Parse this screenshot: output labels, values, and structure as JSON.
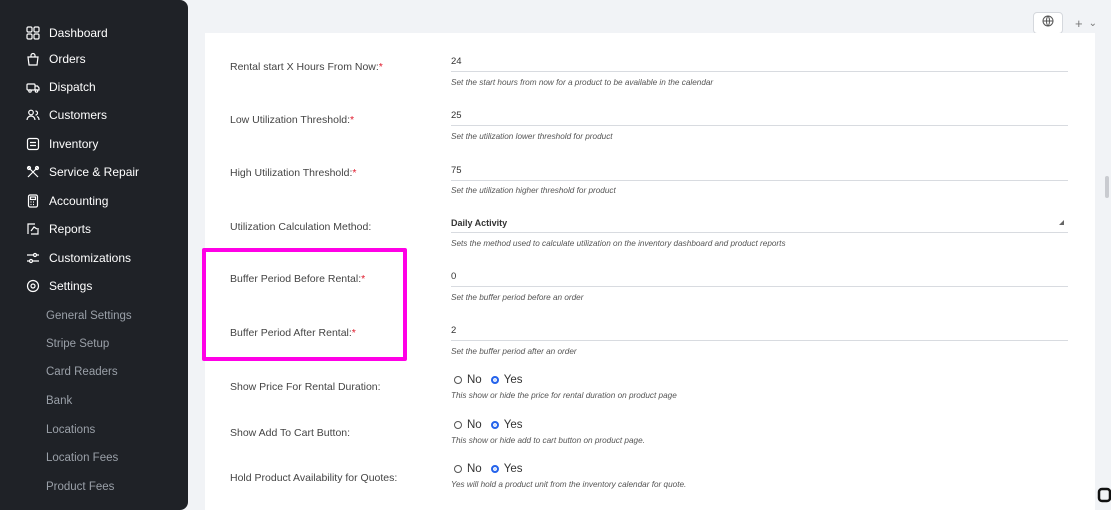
{
  "sidebar": {
    "items": [
      {
        "label": "Dashboard",
        "icon": "dashboard-icon"
      },
      {
        "label": "Orders",
        "icon": "bag-icon"
      },
      {
        "label": "Dispatch",
        "icon": "truck-icon"
      },
      {
        "label": "Customers",
        "icon": "users-icon"
      },
      {
        "label": "Inventory",
        "icon": "inventory-icon"
      },
      {
        "label": "Service & Repair",
        "icon": "tools-icon"
      },
      {
        "label": "Accounting",
        "icon": "calculator-icon"
      },
      {
        "label": "Reports",
        "icon": "reports-icon"
      },
      {
        "label": "Customizations",
        "icon": "sliders-icon"
      },
      {
        "label": "Settings",
        "icon": "gear-icon"
      }
    ],
    "sub_items": [
      "General Settings",
      "Stripe Setup",
      "Card Readers",
      "Bank",
      "Locations",
      "Location Fees",
      "Product Fees"
    ]
  },
  "top_controls": {
    "plus": "+",
    "chevron": "⌄"
  },
  "form": {
    "rental_start": {
      "label": "Rental start X Hours From Now:",
      "required": "*",
      "value": "24",
      "help": "Set the start hours from now for a product to be available in the calendar"
    },
    "low_util": {
      "label": "Low Utilization Threshold:",
      "required": "*",
      "value": "25",
      "help": "Set the utilization lower threshold for product"
    },
    "high_util": {
      "label": "High Utilization Threshold:",
      "required": "*",
      "value": "75",
      "help": "Set the utilization higher threshold for product"
    },
    "util_method": {
      "label": "Utilization Calculation Method:",
      "value": "Daily Activity",
      "help": "Sets the method used to calculate utilization on the inventory dashboard and product reports"
    },
    "buffer_before": {
      "label": "Buffer Period Before Rental:",
      "required": "*",
      "value": "0",
      "help": "Set the buffer period before an order"
    },
    "buffer_after": {
      "label": "Buffer Period After Rental:",
      "required": "*",
      "value": "2",
      "help": "Set the buffer period after an order"
    },
    "show_price": {
      "label": "Show Price For Rental Duration:",
      "no": "No",
      "yes": "Yes",
      "help": "This show or hide the price for rental duration on product page"
    },
    "show_cart": {
      "label": "Show Add To Cart Button:",
      "no": "No",
      "yes": "Yes",
      "help": "This show or hide add to cart button on product page."
    },
    "hold_availability": {
      "label": "Hold Product Availability for Quotes:",
      "no": "No",
      "yes": "Yes",
      "help": "Yes will hold a product unit from the inventory calendar for quote."
    }
  },
  "colors": {
    "sidebar_bg": "#1f2227",
    "highlight": "#ff00e6",
    "required": "#e0192b",
    "radio_selected": "#2563eb"
  }
}
